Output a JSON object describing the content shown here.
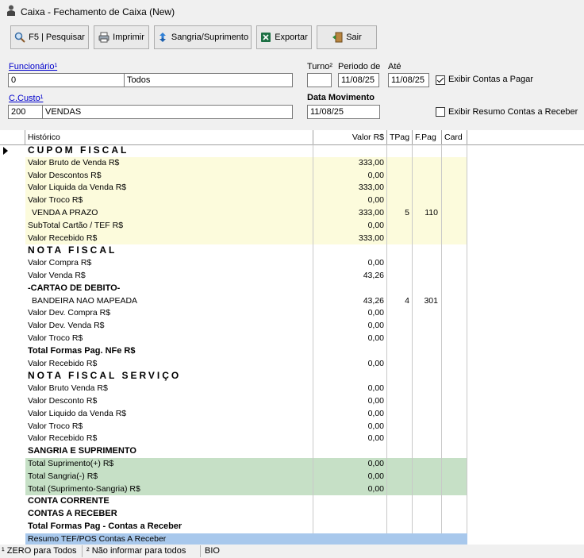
{
  "window": {
    "title": "Caixa - Fechamento de Caixa (New)"
  },
  "toolbar": {
    "pesquisar": "F5 | Pesquisar",
    "imprimir": "Imprimir",
    "sangria": "Sangria/Suprimento",
    "exportar": "Exportar",
    "sair": "Sair"
  },
  "filters": {
    "funcionario_label": "Funcionário¹",
    "funcionario_code": "0",
    "funcionario_name": "Todos",
    "turno_label": "Turno²",
    "turno_value": "",
    "periodo_label": "Periodo de",
    "periodo_value": "11/08/25",
    "ate_label": "Até",
    "ate_value": "11/08/25",
    "exibir_contas_pagar_label": "Exibir Contas a Pagar",
    "exibir_contas_pagar_checked": true,
    "ccusto_label": "C.Custo¹",
    "ccusto_code": "200",
    "ccusto_name": "VENDAS",
    "data_movimento_label": "Data Movimento",
    "data_movimento_value": "11/08/25",
    "exibir_resumo_label": "Exibir Resumo Contas a Receber",
    "exibir_resumo_checked": false
  },
  "grid": {
    "headers": {
      "historico": "Histórico",
      "valor": "Valor R$",
      "tpag": "TPag",
      "fpag": "F.Pag",
      "card": "Card"
    },
    "rows": [
      {
        "h": "CUPOM FISCAL",
        "v": "",
        "t": "",
        "f": "",
        "style": "heading"
      },
      {
        "h": "Valor Bruto de Venda R$",
        "v": "333,00",
        "t": "",
        "f": "",
        "style": "yellow"
      },
      {
        "h": "Valor Descontos R$",
        "v": "0,00",
        "t": "",
        "f": "",
        "style": "yellow"
      },
      {
        "h": "Valor Liquida da Venda R$",
        "v": "333,00",
        "t": "",
        "f": "",
        "style": "yellow"
      },
      {
        "h": "Valor Troco R$",
        "v": "0,00",
        "t": "",
        "f": "",
        "style": "yellow"
      },
      {
        "h": "VENDA A PRAZO",
        "v": "333,00",
        "t": "5",
        "f": "110",
        "style": "yellow indent"
      },
      {
        "h": "SubTotal Cartão / TEF R$",
        "v": "0,00",
        "t": "",
        "f": "",
        "style": "yellow"
      },
      {
        "h": "Valor Recebido R$",
        "v": "333,00",
        "t": "",
        "f": "",
        "style": "yellow"
      },
      {
        "h": "NOTA FISCAL",
        "v": "",
        "t": "",
        "f": "",
        "style": "heading"
      },
      {
        "h": "Valor Compra R$",
        "v": "0,00",
        "t": "",
        "f": "",
        "style": ""
      },
      {
        "h": "Valor Venda R$",
        "v": "43,26",
        "t": "",
        "f": "",
        "style": ""
      },
      {
        "h": "-CARTAO DE DEBITO-",
        "v": "",
        "t": "",
        "f": "",
        "style": "bold"
      },
      {
        "h": "BANDEIRA NAO MAPEADA",
        "v": "43,26",
        "t": "4",
        "f": "301",
        "style": "indent"
      },
      {
        "h": "Valor Dev. Compra R$",
        "v": "0,00",
        "t": "",
        "f": "",
        "style": ""
      },
      {
        "h": "Valor Dev. Venda R$",
        "v": "0,00",
        "t": "",
        "f": "",
        "style": ""
      },
      {
        "h": "Valor Troco R$",
        "v": "0,00",
        "t": "",
        "f": "",
        "style": ""
      },
      {
        "h": "Total Formas Pag. NFe R$",
        "v": "",
        "t": "",
        "f": "",
        "style": "bold"
      },
      {
        "h": "Valor Recebido R$",
        "v": "0,00",
        "t": "",
        "f": "",
        "style": ""
      },
      {
        "h": "NOTA FISCAL SERVIÇO",
        "v": "",
        "t": "",
        "f": "",
        "style": "heading"
      },
      {
        "h": "Valor Bruto Venda R$",
        "v": "0,00",
        "t": "",
        "f": "",
        "style": ""
      },
      {
        "h": "Valor Desconto R$",
        "v": "0,00",
        "t": "",
        "f": "",
        "style": ""
      },
      {
        "h": "Valor Liquido da Venda R$",
        "v": "0,00",
        "t": "",
        "f": "",
        "style": ""
      },
      {
        "h": "Valor Troco R$",
        "v": "0,00",
        "t": "",
        "f": "",
        "style": ""
      },
      {
        "h": "Valor Recebido R$",
        "v": "0,00",
        "t": "",
        "f": "",
        "style": ""
      },
      {
        "h": "SANGRIA E SUPRIMENTO",
        "v": "",
        "t": "",
        "f": "",
        "style": "bold"
      },
      {
        "h": "Total Suprimento(+) R$",
        "v": "0,00",
        "t": "",
        "f": "",
        "style": "green"
      },
      {
        "h": "Total Sangria(-) R$",
        "v": "0,00",
        "t": "",
        "f": "",
        "style": "green"
      },
      {
        "h": "Total (Suprimento-Sangria) R$",
        "v": "0,00",
        "t": "",
        "f": "",
        "style": "green"
      },
      {
        "h": "CONTA CORRENTE",
        "v": "",
        "t": "",
        "f": "",
        "style": "bold"
      },
      {
        "h": "CONTAS A RECEBER",
        "v": "",
        "t": "",
        "f": "",
        "style": "bold"
      },
      {
        "h": "Total Formas Pag - Contas a Receber",
        "v": "",
        "t": "",
        "f": "",
        "style": "bold"
      },
      {
        "h": "Resumo TEF/POS Contas A Receber",
        "v": "",
        "t": "",
        "f": "",
        "style": "blue"
      }
    ]
  },
  "statusbar": {
    "s1": "¹ ZERO para Todos",
    "s2": "² Não informar para todos",
    "s3": "BIO"
  }
}
